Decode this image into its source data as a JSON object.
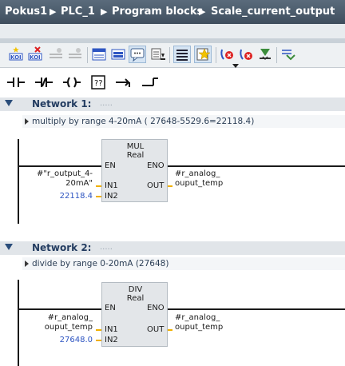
{
  "breadcrumb": [
    "Pokus1",
    "PLC_1",
    "Program blocks",
    "Scale_current_output"
  ],
  "toolbar": {
    "icons": [
      "insert-network-icon",
      "delete-network-icon",
      "insert-row-icon",
      "append-row-icon",
      "absolute-operands-icon",
      "show-favorites-icon",
      "display-comments-icon",
      "abs-rel-icon",
      "toggle-list-icon",
      "favorites-star-icon",
      "monitoring-on-icon",
      "monitoring-off-icon",
      "download-icon",
      "compare-icon"
    ]
  },
  "favorites": [
    "normally-open-contact-icon",
    "normally-closed-contact-icon",
    "coil-icon",
    "empty-box-icon",
    "open-branch-icon",
    "close-branch-icon"
  ],
  "colors": {
    "titlebar": "#4a5b6c",
    "network_title": "#243d61",
    "constant_blue": "#2e55c2",
    "pin_stub": "#f0b000"
  },
  "networks": [
    {
      "title": "Network 1:",
      "dots": ".....",
      "comment": "multiply  by range  4-20mA ( 27648-5529.6=22118.4)",
      "block": {
        "op": "MUL",
        "type": "Real",
        "en": "EN",
        "eno": "ENO",
        "in1": "IN1",
        "in2": "IN2",
        "out": "OUT",
        "in1_line1": "#\"r_output_4-",
        "in1_line2": "20mA\"",
        "in2_value": "22118.4",
        "out_line1": "#r_analog_",
        "out_line2": "ouput_temp"
      }
    },
    {
      "title": "Network 2:",
      "dots": ".....",
      "comment": "divide by range  0-20mA (27648)",
      "block": {
        "op": "DIV",
        "type": "Real",
        "en": "EN",
        "eno": "ENO",
        "in1": "IN1",
        "in2": "IN2",
        "out": "OUT",
        "in1_line1": "#r_analog_",
        "in1_line2": "ouput_temp",
        "in2_value": "27648.0",
        "out_line1": "#r_analog_",
        "out_line2": "ouput_temp"
      }
    }
  ]
}
